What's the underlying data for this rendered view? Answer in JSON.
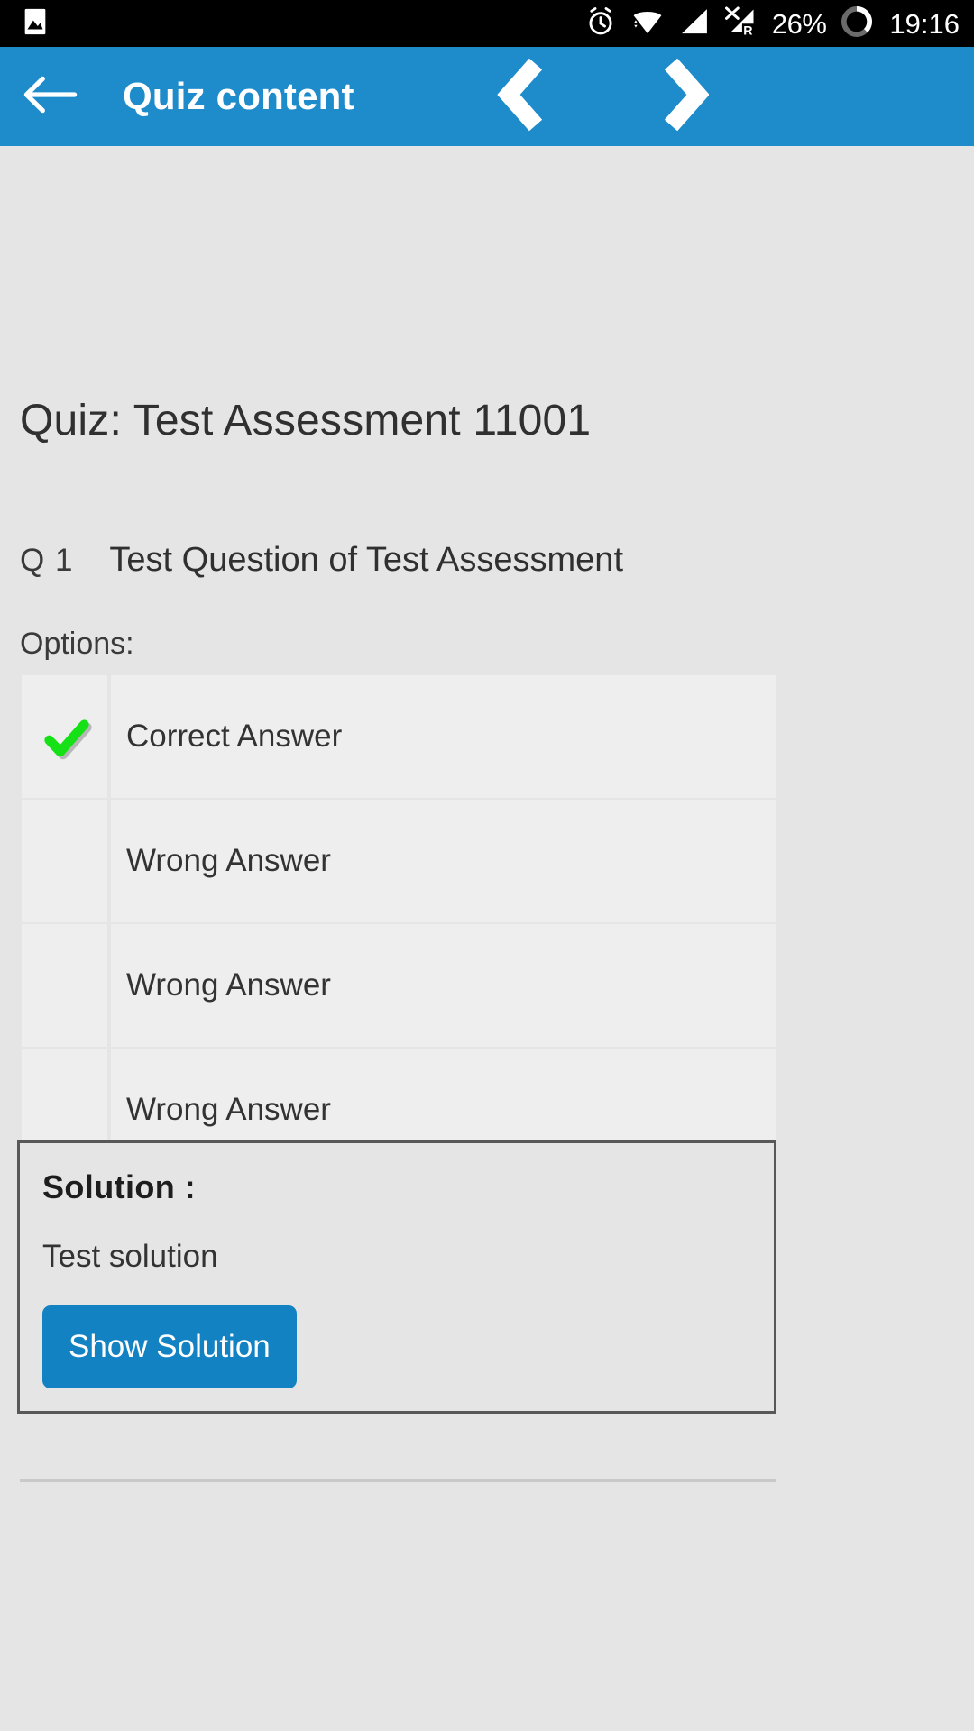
{
  "status_bar": {
    "icons": [
      "image-icon",
      "alarm-icon",
      "wifi-icon",
      "signal-icon",
      "signal-roaming-off-icon",
      "battery-circle-icon"
    ],
    "battery_percent": "26%",
    "time": "19:16",
    "background": "#000000",
    "foreground": "#ffffff"
  },
  "app_bar": {
    "title": "Quiz content",
    "back_icon": "arrow-left-icon",
    "prev_icon": "chevron-left-icon",
    "next_icon": "chevron-right-icon",
    "background": "#1e8bcb",
    "foreground": "#ffffff"
  },
  "quiz": {
    "title": "Quiz: Test Assessment 11001",
    "question_number": "Q 1",
    "question_text": "Test Question of Test Assessment",
    "options_label": "Options:",
    "options": [
      {
        "marker": "check-icon",
        "is_correct": true,
        "label": "Correct Answer"
      },
      {
        "marker": "",
        "is_correct": false,
        "label": "Wrong Answer"
      },
      {
        "marker": "",
        "is_correct": false,
        "label": "Wrong Answer"
      },
      {
        "marker": "",
        "is_correct": false,
        "label": "Wrong Answer"
      }
    ],
    "correct_color": "#16e116"
  },
  "solution": {
    "heading": "Solution :",
    "text": "Test solution",
    "button_label": "Show Solution",
    "button_color": "#1282c3"
  }
}
